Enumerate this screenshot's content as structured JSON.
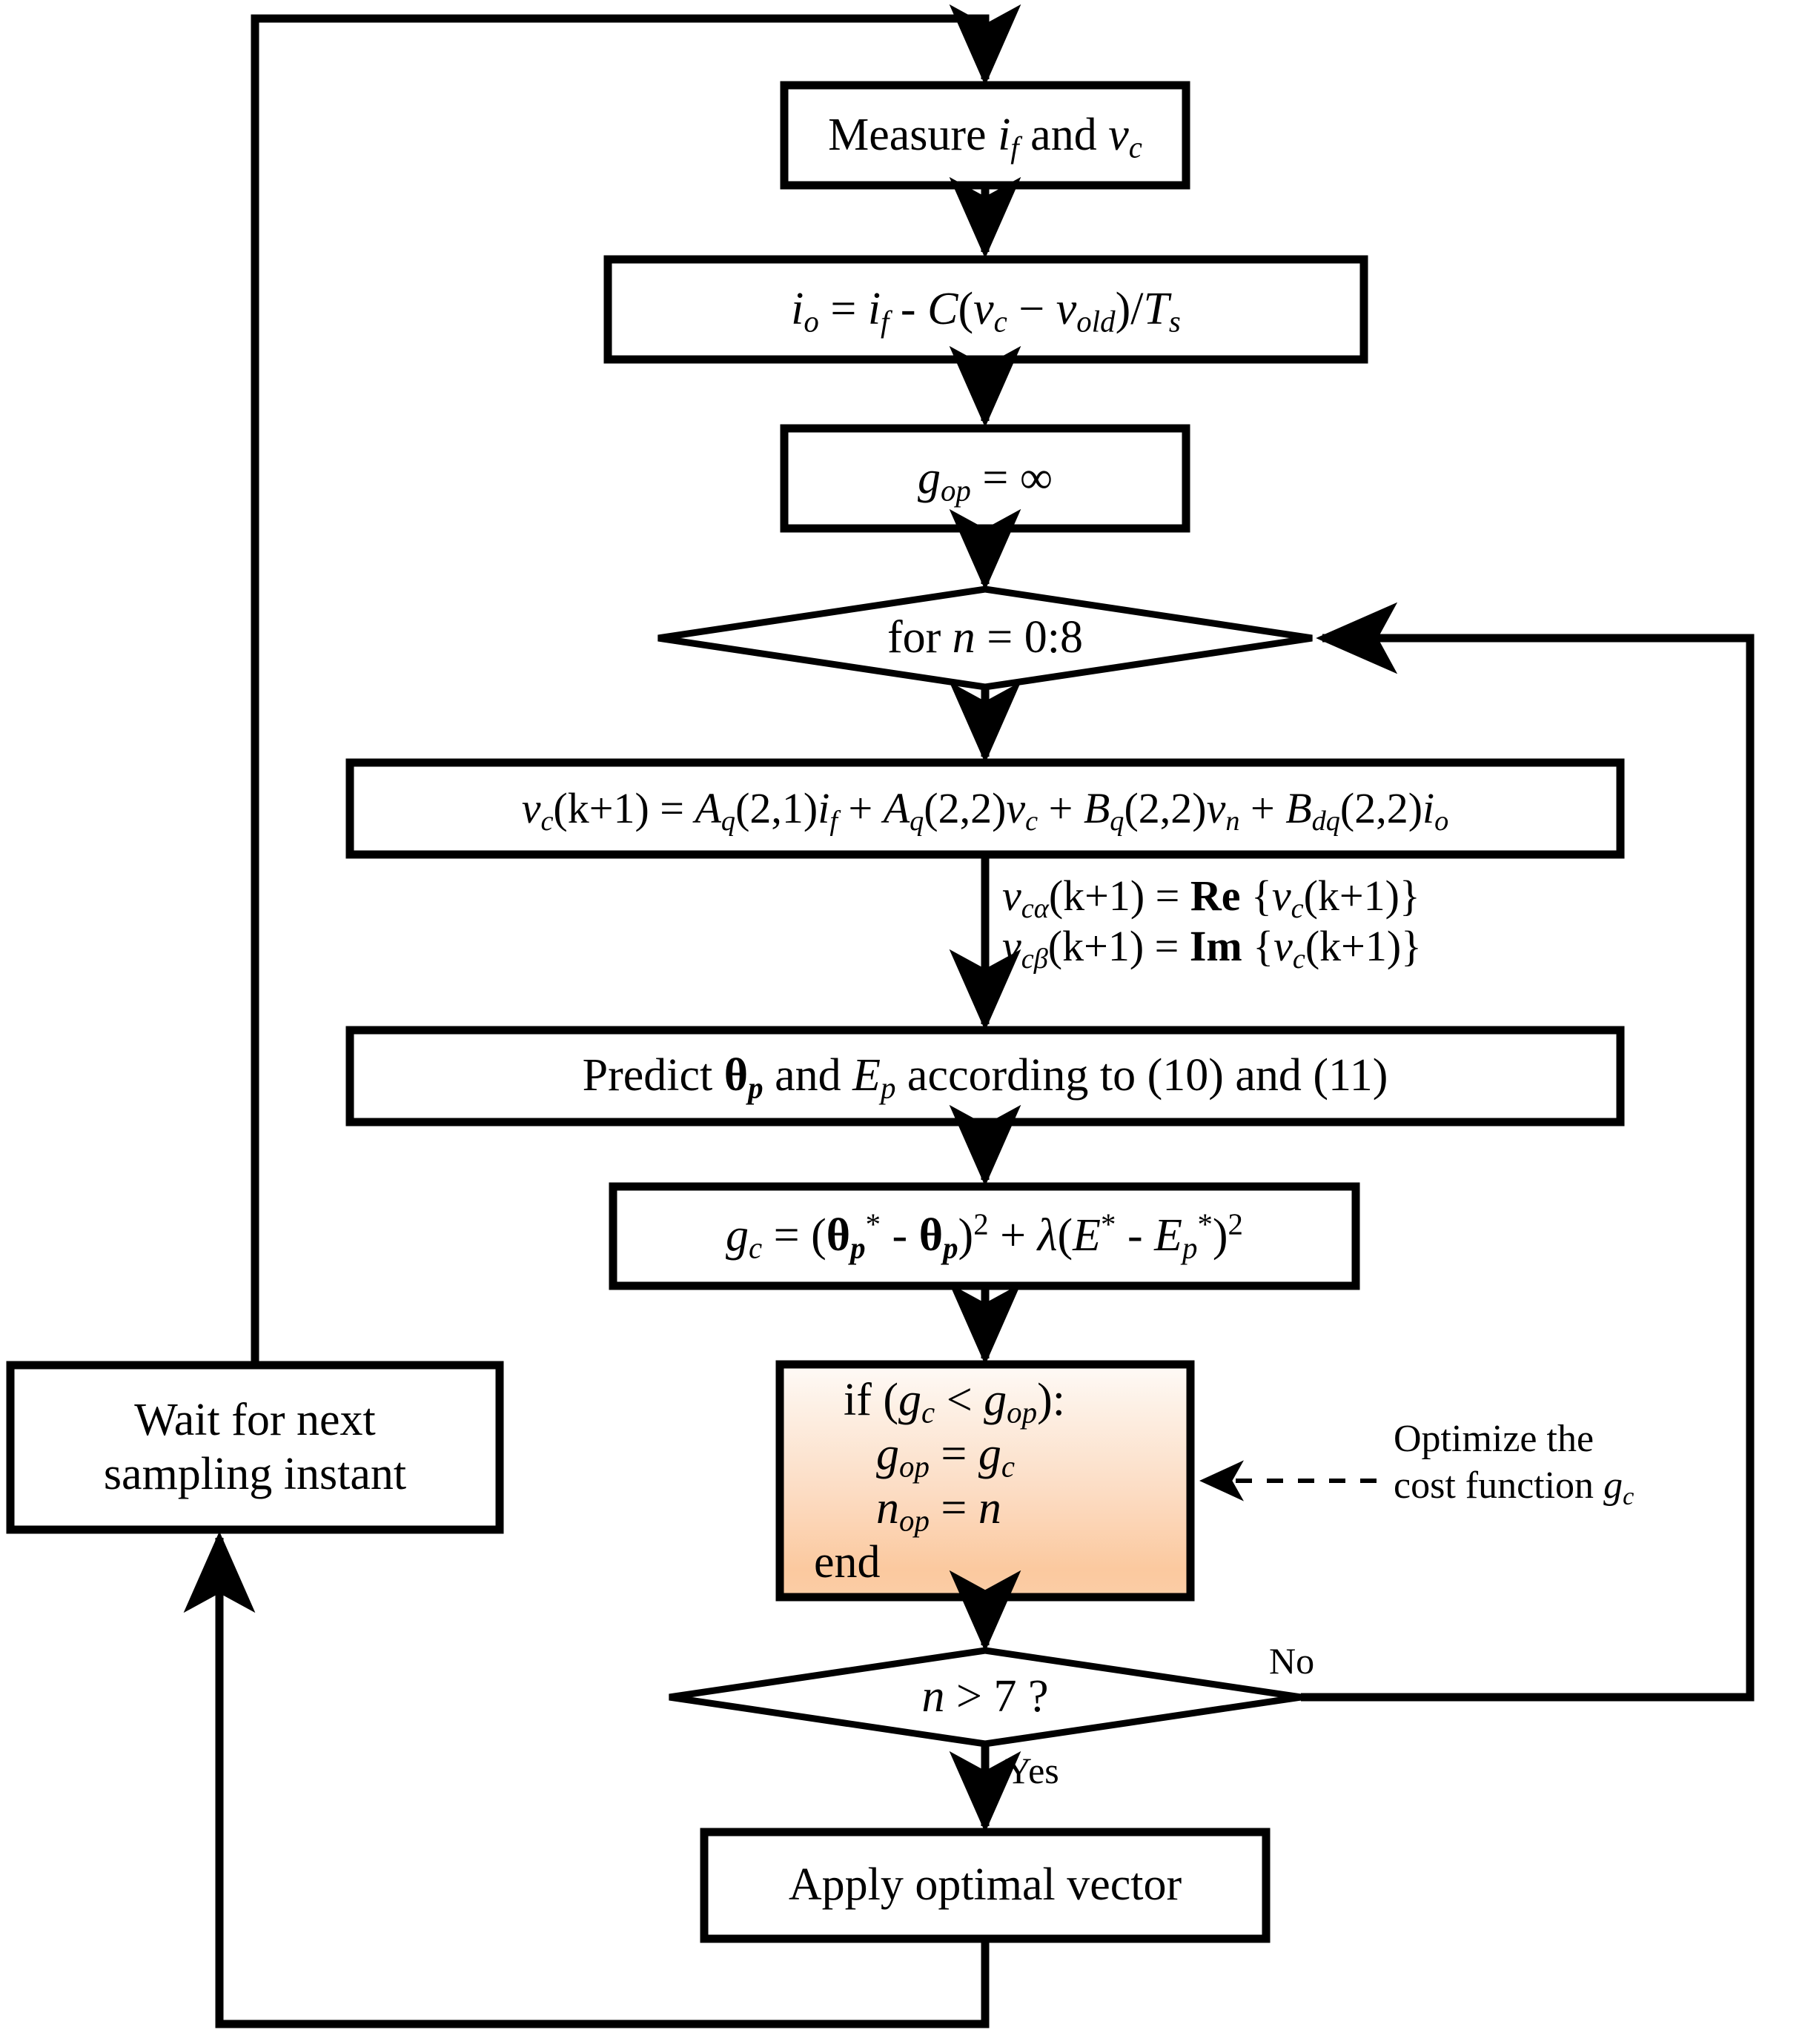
{
  "diagram": {
    "title": "Predictive control algorithm flowchart",
    "colors": {
      "stroke": "#000000",
      "background": "#ffffff",
      "highlight_top": "#fdf5ef",
      "highlight_bottom": "#fbcaa2",
      "highlight_border": "#000000"
    }
  },
  "nodes": {
    "measure": {
      "shape": "process",
      "text_plain": "Measure i_f and v_c",
      "parts": {
        "lead": "Measure ",
        "var1": "i",
        "var1_sub": "f",
        "mid": " and ",
        "var2": "v",
        "var2_sub": "c"
      }
    },
    "current_calc": {
      "shape": "process",
      "text_plain": "i_o = i_f - C(v_c - v_old)/T_s",
      "parts": {
        "lhs": "i",
        "lhs_sub": "o",
        "eq": " = ",
        "t1": "i",
        "t1_sub": "f",
        "minus": " - ",
        "cap": "C",
        "open": "(",
        "t2": "v",
        "t2_sub": "c",
        "dash": " − ",
        "t3": "v",
        "t3_sub": "old",
        "close": ")/",
        "t4": "T",
        "t4_sub": "s"
      }
    },
    "init_gop": {
      "shape": "process",
      "text_plain": "g_op = ∞",
      "parts": {
        "g": "g",
        "g_sub": "op",
        "eq": " = ",
        "inf": "∞"
      }
    },
    "for_loop": {
      "shape": "decision",
      "text_plain": "for n = 0:8",
      "parts": {
        "lead": "for ",
        "n": "n",
        "rest": " = 0:8"
      }
    },
    "predict_vc": {
      "shape": "process",
      "text_plain": "v_c(k+1) = A_q(2,1)i_f + A_q(2,2)v_c + B_q(2,2)v_n + B_dq(2,2)i_o",
      "parts": {
        "lhs": "v",
        "lhs_sub": "c",
        "lhs_arg": "(k+1)",
        "eq": " = ",
        "a1": "A",
        "a1_sub": "q",
        "a1_arg": "(2,1)",
        "a1_var": "i",
        "a1_var_sub": "f",
        "p1": " + ",
        "a2": "A",
        "a2_sub": "q",
        "a2_arg": "(2,2)",
        "a2_var": "v",
        "a2_var_sub": "c",
        "p2": " + ",
        "b1": "B",
        "b1_sub": "q",
        "b1_arg": "(2,2)",
        "b1_var": "v",
        "b1_var_sub": "n",
        "p3": " + ",
        "b2": "B",
        "b2_sub": "dq",
        "b2_arg": "(2,2)",
        "b2_var": "i",
        "b2_var_sub": "o"
      }
    },
    "alpha_beta": {
      "shape": "annotation",
      "line1_plain": "v_cα(k+1) = Re {v_c(k+1)}",
      "line2_plain": "v_cβ(k+1) = Im {v_c(k+1)}",
      "parts": {
        "v": "v",
        "sub_alpha": "cα",
        "sub_beta": "cβ",
        "arg": "(k+1)",
        "eq": " = ",
        "re": "Re",
        "im": "Im",
        "brace_open": " {",
        "inner": "v",
        "inner_sub": "c",
        "inner_arg": "(k+1)",
        "brace_close": "}"
      }
    },
    "predict_theta": {
      "shape": "process",
      "text_plain": "Predict θ_p and E_p according to (10) and (11)",
      "parts": {
        "lead": "Predict ",
        "theta": "θ",
        "theta_sub": "p",
        "mid": " and ",
        "e": "E",
        "e_sub": "p",
        "tail": " according to (10) and (11)"
      }
    },
    "cost": {
      "shape": "process",
      "text_plain": "g_c = (θ_p* - θ_p)^2 + λ(E* - E_p*)^2",
      "parts": {
        "g": "g",
        "g_sub": "c",
        "eq": " = ",
        "open1": "(",
        "th1": "θ",
        "th1_sub": "p",
        "star1": "*",
        "minus": " - ",
        "th2": "θ",
        "th2_sub": "p",
        "close1": ")",
        "sq1": "2",
        "plus": " + ",
        "lam": "λ",
        "open2": "(",
        "e1": "E",
        "star2": "*",
        "minus2": " - ",
        "e2": "E",
        "e2_sub": "p",
        "star3": "*",
        "close2": ")",
        "sq2": "2"
      }
    },
    "optimize_block": {
      "shape": "process-highlighted",
      "line1_plain": "if (g_c < g_op):",
      "line2_plain": "g_op = g_c",
      "line3_plain": "n_op = n",
      "line4_plain": "end",
      "parts": {
        "if_lead": "if (",
        "g1": "g",
        "g1_sub": "c",
        "lt": " < ",
        "g2": "g",
        "g2_sub": "op",
        "if_tail": "):",
        "a_lhs": "g",
        "a_lhs_sub": "op",
        "a_eq": " = ",
        "a_rhs": "g",
        "a_rhs_sub": "c",
        "b_lhs": "n",
        "b_lhs_sub": "op",
        "b_eq": " = ",
        "b_rhs": "n",
        "end": "end"
      }
    },
    "check_n": {
      "shape": "decision",
      "text_plain": "n > 7 ?",
      "parts": {
        "n": "n",
        "rest": " > 7 ?"
      }
    },
    "apply": {
      "shape": "process",
      "text_plain": "Apply optimal vector"
    },
    "wait": {
      "shape": "process",
      "line1": "Wait for next",
      "line2": "sampling instant"
    }
  },
  "annotations": {
    "optimize_note": {
      "line1": "Optimize the",
      "line2_lead": "cost function ",
      "line2_var": "g",
      "line2_sub": "c",
      "text_plain": "Optimize the cost function g_c",
      "arrow_style": "dashed",
      "arrow_direction": "left"
    }
  },
  "edge_labels": {
    "no": "No",
    "yes": "Yes"
  }
}
